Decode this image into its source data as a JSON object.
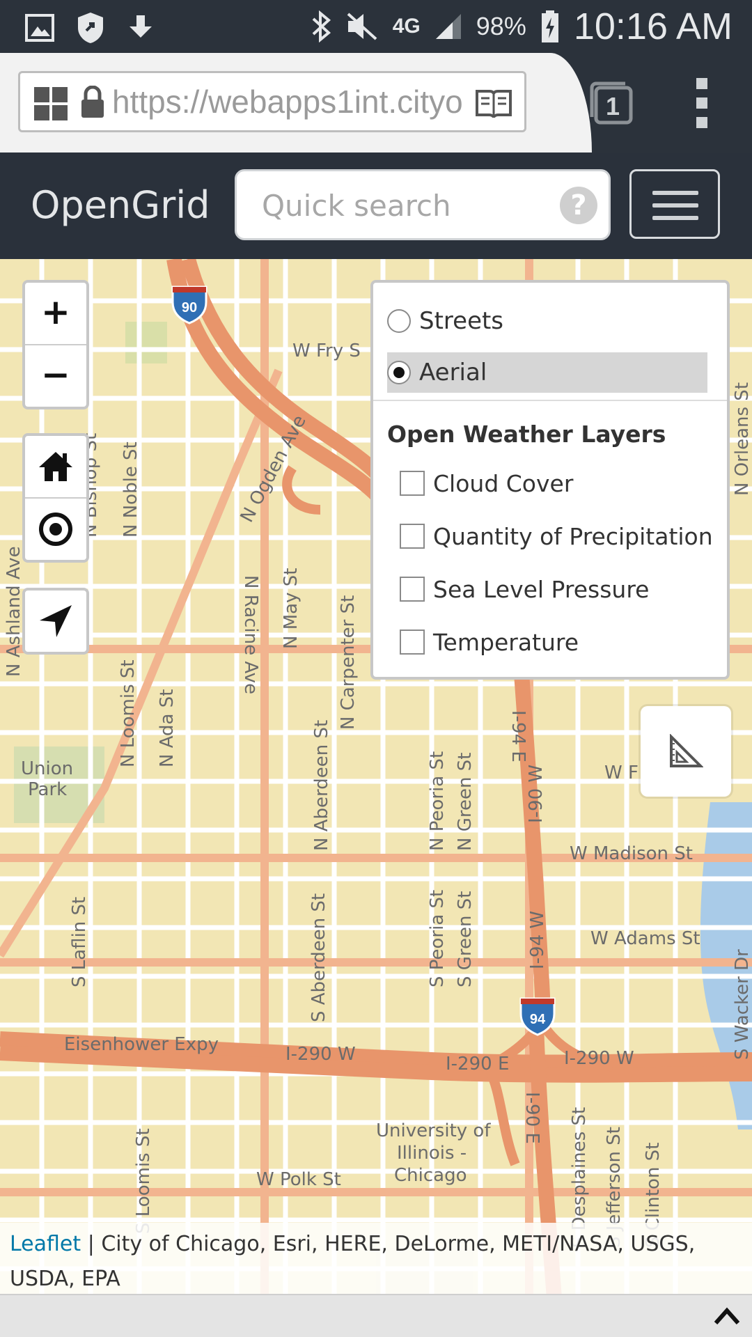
{
  "status_bar": {
    "battery": "98%",
    "time": "10:16 AM",
    "network": "4G",
    "icons": [
      "gallery-icon",
      "shield-icon",
      "download-icon",
      "bluetooth-icon",
      "mute-icon",
      "lte-icon",
      "signal-icon",
      "battery-charging-icon"
    ]
  },
  "browser": {
    "url": "https://webapps1int.cityo",
    "tab_count": "1",
    "icons": [
      "apps-icon",
      "lock-icon",
      "reader-mode-icon",
      "tabs-icon",
      "menu-dots-icon"
    ]
  },
  "navbar": {
    "brand": "OpenGrid",
    "search_placeholder": "Quick search",
    "help_label": "?"
  },
  "map": {
    "zoom_in_label": "+",
    "zoom_out_label": "−",
    "labels": {
      "w_fry": "W Fry S",
      "ogden": "N Ogden Ave",
      "bishop": "N Bishop St",
      "noble": "N Noble St",
      "ashland": "N Ashland Ave",
      "racine": "N Racine Ave",
      "may": "N May St",
      "carpenter": "N Carpenter St",
      "loomis": "N Loomis St",
      "ada": "N Ada St",
      "aberdeen_n": "N Aberdeen St",
      "peoria_n": "N Peoria St",
      "green_n": "N Green St",
      "union_park_1": "Union",
      "union_park_2": "Park",
      "w_madison": "W Madison St",
      "w_adams": "W Adams St",
      "laflin": "S Laflin St",
      "aberdeen_s": "S Aberdeen St",
      "peoria_s": "S Peoria St",
      "green_s": "S Green St",
      "i90e_top": "I-94 E",
      "i90w": "I-90 W",
      "i94w": "I-94 W",
      "eisenhower": "Eisenhower Expy",
      "i290w_left": "I-290 W",
      "i290e": "I-290 E",
      "i290w_right": "I-290 W",
      "i90e_bottom": "I-90 E",
      "desplaines": "S Desplaines St",
      "jefferson": "S Jefferson St",
      "clinton": "S Clinton St",
      "uic_1": "University of",
      "uic_2": "Illinois -",
      "uic_3": "Chicago",
      "w_polk": "W Polk St",
      "s_loomis": "S Loomis St",
      "n_orleans": "N Orleans St",
      "wacker": "S Wacker Dr",
      "w_f": "W F",
      "shield_90": "90",
      "shield_94": "94"
    }
  },
  "layers_panel": {
    "base_layers": [
      {
        "label": "Streets",
        "selected": false
      },
      {
        "label": "Aerial",
        "selected": true
      }
    ],
    "overlay_heading": "Open Weather Layers",
    "overlays": [
      {
        "label": "Cloud Cover",
        "checked": false
      },
      {
        "label": "Quantity of Precipitation",
        "checked": false
      },
      {
        "label": "Sea Level Pressure",
        "checked": false
      },
      {
        "label": "Temperature",
        "checked": false
      }
    ]
  },
  "attribution": {
    "link": "Leaflet",
    "text": " | City of Chicago, Esri, HERE, DeLorme, METI/NASA, USGS, USDA, EPA"
  },
  "colors": {
    "navbar": "#2a313b",
    "map_land": "#f2e6b4",
    "road_major": "#e8956b",
    "road_minor": "#ffffff",
    "water": "#a9cbe8",
    "link": "#0078a8"
  }
}
